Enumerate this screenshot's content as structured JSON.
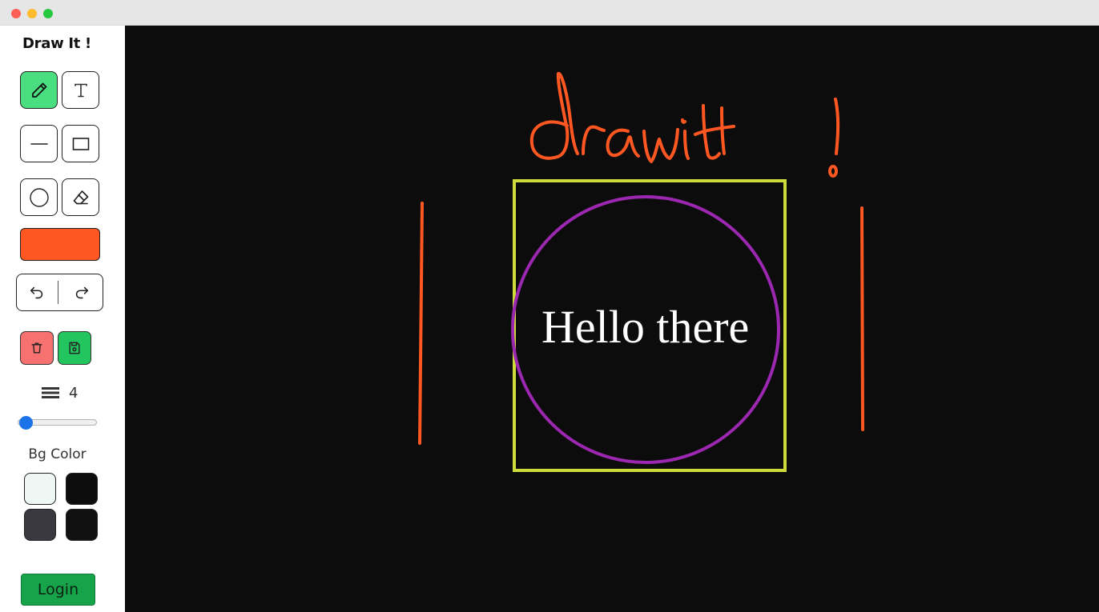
{
  "window": {
    "controls": [
      "close",
      "minimize",
      "zoom"
    ]
  },
  "sidebar": {
    "title": "Draw It !",
    "tools": [
      {
        "name": "pencil",
        "icon": "pencil-icon",
        "active": true
      },
      {
        "name": "text",
        "icon": "text-icon",
        "active": false
      },
      {
        "name": "line",
        "icon": "line-icon",
        "active": false
      },
      {
        "name": "rectangle",
        "icon": "rectangle-icon",
        "active": false
      },
      {
        "name": "circle",
        "icon": "circle-icon",
        "active": false
      },
      {
        "name": "eraser",
        "icon": "eraser-icon",
        "active": false
      }
    ],
    "stroke_color": "#ff5722",
    "history": {
      "undo_icon": "undo-icon",
      "redo_icon": "redo-icon"
    },
    "actions": {
      "clear": {
        "icon": "trash-icon",
        "color": "#f87171"
      },
      "save": {
        "icon": "save-icon",
        "color": "#22c55e"
      }
    },
    "stroke_width": {
      "icon": "lines-icon",
      "value": "4",
      "fraction": 0.03
    },
    "bg_label": "Bg Color",
    "bg_colors": [
      "#eef7f4",
      "#0c0c0c",
      "#3a393f",
      "#111111"
    ],
    "login_label": "Login",
    "active_tool_color": "#4ade80"
  },
  "canvas": {
    "background": "#0c0c0c",
    "text": "Hello there",
    "text_color": "#ffffff",
    "handwriting": "draw it!",
    "shapes": [
      {
        "type": "line",
        "color": "#ff5722"
      },
      {
        "type": "line",
        "color": "#ff5722"
      },
      {
        "type": "rectangle",
        "color": "#cddc39"
      },
      {
        "type": "circle",
        "color": "#9c27b0"
      },
      {
        "type": "freehand",
        "color": "#ff5722"
      }
    ]
  }
}
